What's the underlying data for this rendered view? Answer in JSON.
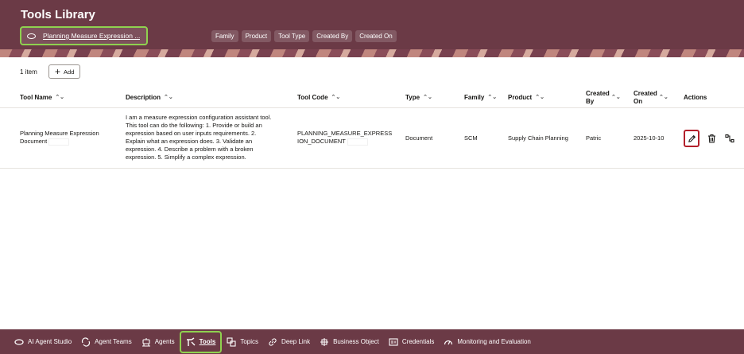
{
  "header": {
    "title": "Tools Library",
    "search_chip": "Planning Measure Expression ...",
    "filters": [
      "Family",
      "Product",
      "Tool Type",
      "Created By",
      "Created On"
    ]
  },
  "toolbar": {
    "count": "1 item",
    "add_label": "Add"
  },
  "table": {
    "columns": [
      "Tool Name",
      "Description",
      "Tool Code",
      "Type",
      "Family",
      "Product",
      "Created By",
      "Created On",
      "Actions"
    ],
    "rows": [
      {
        "tool_name_line1": "Planning Measure Expression",
        "tool_name_line2": "Document",
        "description_lines": [
          "I am a measure expression configuration assistant tool.",
          "This tool can do the following: 1. Provide or build an",
          "expression based on user inputs requirements. 2.",
          "Explain what an expression does. 3. Validate an",
          "expression. 4. Describe a problem with a broken",
          "expression. 5. Simplify a complex expression."
        ],
        "tool_code_line1": "PLANNING_MEASURE_EXPRESS",
        "tool_code_line2": "ION_DOCUMENT",
        "type": "Document",
        "family": "SCM",
        "product": "Supply Chain Planning",
        "created_by": "Patric",
        "created_on": "2025-10-10"
      }
    ]
  },
  "bottom_nav": [
    {
      "label": "AI Agent Studio",
      "icon": "oval-icon"
    },
    {
      "label": "Agent Teams",
      "icon": "link-arrows-icon"
    },
    {
      "label": "Agents",
      "icon": "robot-icon"
    },
    {
      "label": "Tools",
      "icon": "tools-icon",
      "active": true
    },
    {
      "label": "Topics",
      "icon": "topics-icon"
    },
    {
      "label": "Deep Link",
      "icon": "link-icon"
    },
    {
      "label": "Business Object",
      "icon": "object-icon"
    },
    {
      "label": "Credentials",
      "icon": "credentials-icon"
    },
    {
      "label": "Monitoring and Evaluation",
      "icon": "gauge-icon"
    }
  ],
  "colors": {
    "brand": "#6b3a46",
    "highlight_green": "#8fd14f",
    "highlight_red": "#b3202b"
  }
}
